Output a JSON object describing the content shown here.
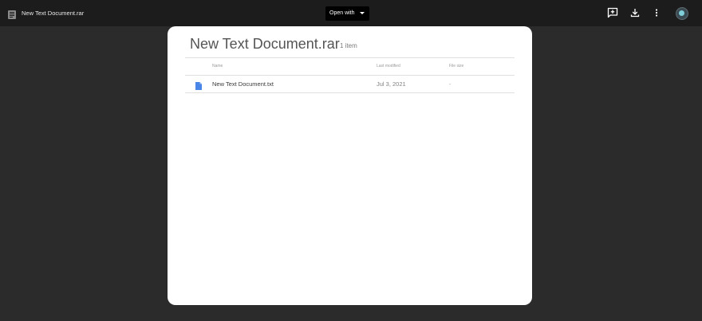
{
  "topbar": {
    "file_title": "New Text Document.rar",
    "open_with_label": "Open with",
    "icons": [
      "file-icon",
      "add-comment-icon",
      "download-icon",
      "more-vert-icon",
      "avatar"
    ]
  },
  "archive": {
    "title": "New Text Document.rar",
    "item_count": "1 item",
    "columns": {
      "name": "Name",
      "last_modified": "Last modified",
      "file_size": "File size"
    },
    "rows": [
      {
        "icon": "document-icon",
        "name": "New Text Document.txt",
        "last_modified": "Jul 3, 2021",
        "file_size": "-"
      }
    ]
  },
  "colors": {
    "background": "#2b2b2b",
    "topbar": "#1c1c1c",
    "panel": "#ffffff",
    "doc_icon": "#4a86e8"
  }
}
